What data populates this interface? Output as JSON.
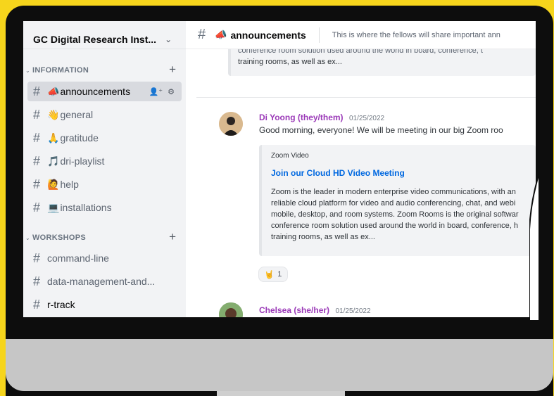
{
  "sidebar": {
    "server_name": "GC Digital Research Inst...",
    "categories": [
      {
        "label": "INFORMATION"
      },
      {
        "label": "WORKSHOPS"
      }
    ],
    "channels": [
      {
        "emoji": "📣",
        "label": "announcements"
      },
      {
        "emoji": "👋",
        "label": "general"
      },
      {
        "emoji": "🙏",
        "label": "gratitude"
      },
      {
        "emoji": "🎵",
        "label": "dri-playlist"
      },
      {
        "emoji": "🙋",
        "label": "help"
      },
      {
        "emoji": "💻",
        "label": "installations"
      },
      {
        "emoji": "",
        "label": "command-line"
      },
      {
        "emoji": "",
        "label": "data-management-and..."
      },
      {
        "emoji": "",
        "label": "r-track"
      }
    ]
  },
  "topbar": {
    "channel_emoji": "📣",
    "channel_name": "announcements",
    "topic": "This is where the fellows will share important ann"
  },
  "messages": {
    "first_embed": {
      "line1": "conference room solution used around the world in board, conference, t",
      "line2": "training rooms, as well as ex..."
    },
    "di": {
      "author": "Di Yoong (they/them)",
      "timestamp": "01/25/2022",
      "text": "Good morning, everyone! We will be meeting in our big Zoom roo",
      "embed": {
        "provider": "Zoom Video",
        "title": "Join our Cloud HD Video Meeting",
        "lines": [
          "Zoom is the leader in modern enterprise video communications, with an",
          "reliable cloud platform for video and audio conferencing, chat, and webi",
          "mobile, desktop, and room systems. Zoom Rooms is the original softwar",
          "conference room solution used around the world in board, conference, h",
          "training rooms, as well as ex..."
        ]
      },
      "reaction": {
        "emoji": "🤘",
        "count": "1"
      }
    },
    "chelsea": {
      "author": "Chelsea (she/her)",
      "timestamp": "01/25/2022"
    }
  },
  "colors": {
    "background": "#f6d51c",
    "bezel": "#0d0d0d",
    "chin": "#c6c6c6",
    "sidebar": "#f2f3f5",
    "author": "#9b3ab8",
    "link": "#0068e0"
  },
  "icons": {
    "chevron": "chevron-down-icon",
    "add_channel": "plus-icon",
    "add_member": "add-member-icon",
    "settings": "gear-icon",
    "channel": "hash-icon"
  }
}
